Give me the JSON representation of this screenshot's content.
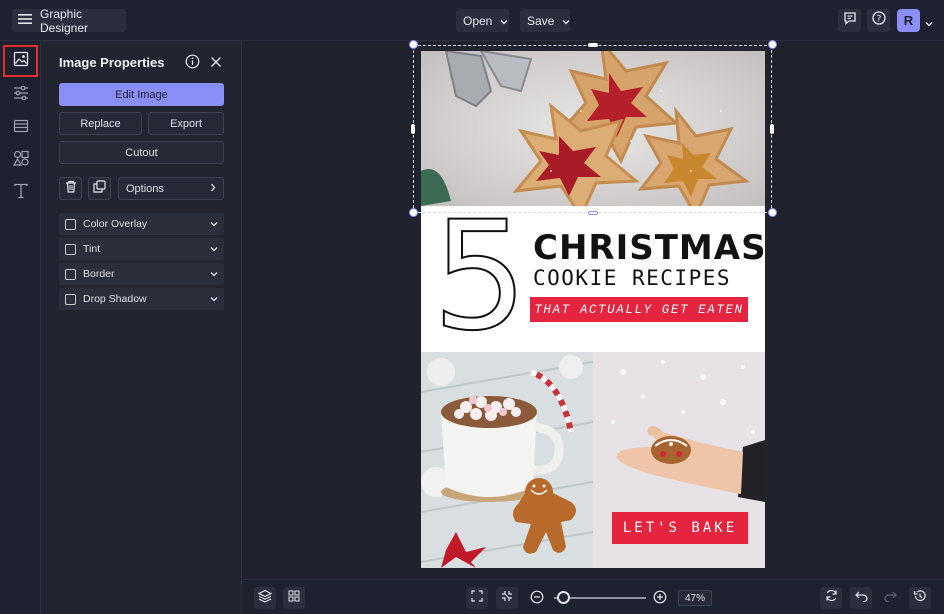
{
  "app": {
    "title": "Graphic Designer"
  },
  "topbar": {
    "open_label": "Open",
    "save_label": "Save",
    "avatar_letter": "R"
  },
  "rail": {
    "items": [
      {
        "name": "image-properties",
        "active": true
      },
      {
        "name": "adjustments"
      },
      {
        "name": "layouts"
      },
      {
        "name": "graphics"
      },
      {
        "name": "text"
      }
    ]
  },
  "panel": {
    "title": "Image Properties",
    "edit_image_label": "Edit Image",
    "replace_label": "Replace",
    "export_label": "Export",
    "cutout_label": "Cutout",
    "options_label": "Options",
    "effects": [
      {
        "label": "Color Overlay",
        "checked": false
      },
      {
        "label": "Tint",
        "checked": false
      },
      {
        "label": "Border",
        "checked": false
      },
      {
        "label": "Drop Shadow",
        "checked": false
      }
    ]
  },
  "poster": {
    "number": "5",
    "line1": "CHRISTMAS",
    "line2": "COOKIE RECIPES",
    "tagline": "THAT ACTUALLY GET EATEN",
    "cta": "LET'S BAKE"
  },
  "zoom": {
    "value_label": "47%",
    "level": 0.47
  },
  "colors": {
    "accent": "#8a8ff7",
    "highlight": "#e0302d",
    "poster_red": "#e5243f"
  }
}
